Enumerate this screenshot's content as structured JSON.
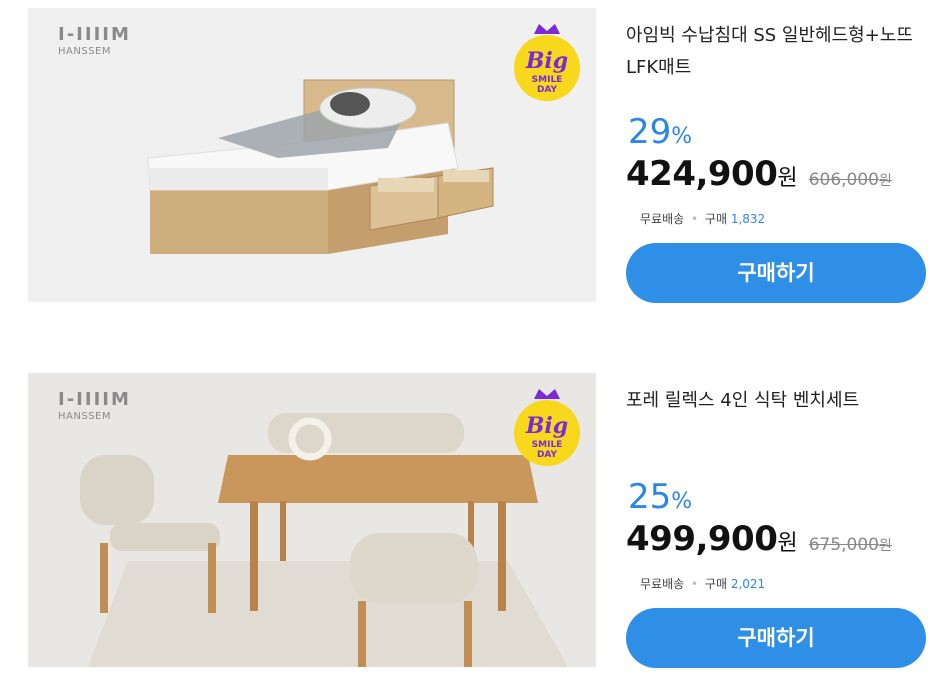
{
  "products": [
    {
      "brand_mark": "I-IIIIM",
      "brand_name": "HANSSEM",
      "badge": {
        "top": "Big",
        "line1": "SMILE",
        "line2": "DAY"
      },
      "title_line1": "아임빅 수납침대 SS 일반헤드형+노뜨",
      "title_line2": "LFK매트",
      "discount": "29",
      "discount_unit": "%",
      "price": "424,900",
      "price_unit": "원",
      "original_price": "606,000",
      "original_unit": "원",
      "shipping": "무료배송",
      "purchase_label": "구매",
      "purchase_count": "1,832",
      "buy_label": "구매하기"
    },
    {
      "brand_mark": "I-IIIIM",
      "brand_name": "HANSSEM",
      "badge": {
        "top": "Big",
        "line1": "SMILE",
        "line2": "DAY"
      },
      "title_line1": "포레 릴렉스 4인 식탁 벤치세트",
      "title_line2": "",
      "discount": "25",
      "discount_unit": "%",
      "price": "499,900",
      "price_unit": "원",
      "original_price": "675,000",
      "original_unit": "원",
      "shipping": "무료배송",
      "purchase_label": "구매",
      "purchase_count": "2,021",
      "buy_label": "구매하기"
    }
  ],
  "colors": {
    "accent": "#2b87e3",
    "button": "#2f8ee5",
    "badge_yellow": "#f7d81c",
    "badge_purple": "#7a2bd6"
  }
}
